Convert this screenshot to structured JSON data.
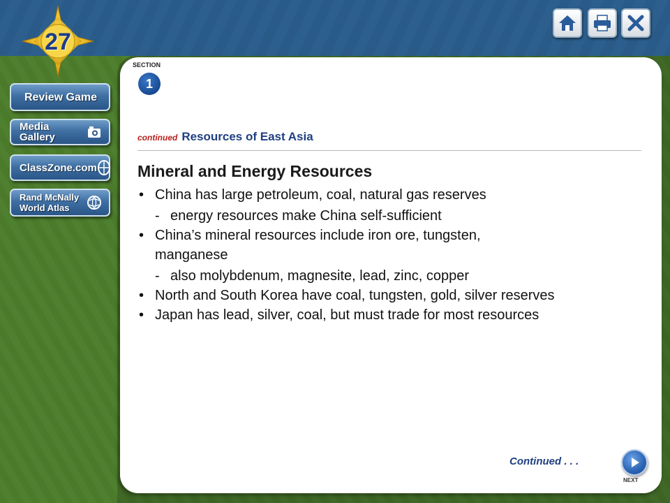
{
  "chapter": {
    "number": "27"
  },
  "sidebar": {
    "review_game": "Review Game",
    "media_gallery": "Media Gallery",
    "classzone": "ClassZone.com",
    "atlas_line1": "Rand McNally",
    "atlas_line2": "World Atlas"
  },
  "toolbar": {
    "icons": [
      "home-icon",
      "print-icon",
      "close-icon"
    ]
  },
  "section": {
    "label": "SECTION",
    "number": "1"
  },
  "subhead": {
    "continued": "continued",
    "title": "Resources of East Asia"
  },
  "main": {
    "title": "Mineral and Energy Resources",
    "items": [
      {
        "type": "bullet",
        "text": "China has large petroleum, coal, natural gas reserves"
      },
      {
        "type": "sub",
        "text": "energy resources make China self-sufficient"
      },
      {
        "type": "bullet",
        "text": "China’s mineral resources include iron ore, tungsten, manganese"
      },
      {
        "type": "sub",
        "text": "also molybdenum, magnesite, lead, zinc, copper"
      },
      {
        "type": "bullet",
        "text": "North and South Korea have coal, tungsten, gold, silver reserves"
      },
      {
        "type": "bullet",
        "text": "Japan has lead, silver, coal, but must trade for most resources"
      }
    ]
  },
  "footer": {
    "continued": "Continued . . .",
    "next_label": "NEXT"
  },
  "colors": {
    "accent_blue": "#1f3f82",
    "accent_red": "#b8201c",
    "frame_green": "#4b7a2b",
    "frame_blue": "#2a5b88"
  }
}
